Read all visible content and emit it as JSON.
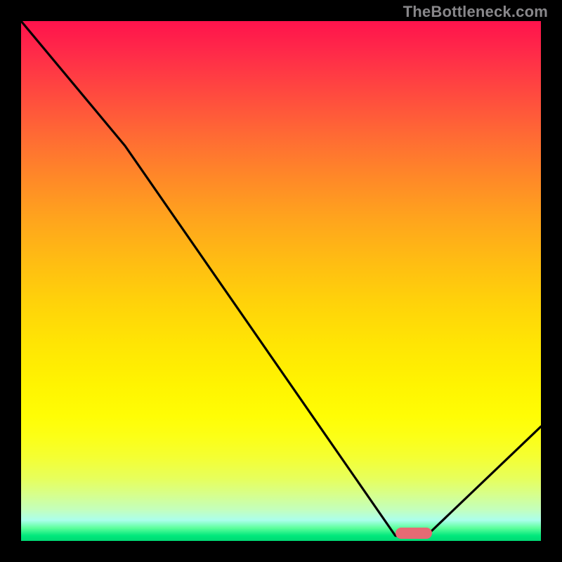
{
  "watermark": "TheBottleneck.com",
  "chart_data": {
    "type": "line",
    "title": "",
    "xlabel": "",
    "ylabel": "",
    "xlim": [
      0,
      100
    ],
    "ylim": [
      0,
      100
    ],
    "grid": false,
    "series": [
      {
        "name": "bottleneck-curve",
        "x": [
          0,
          20,
          72,
          78,
          100
        ],
        "values": [
          100,
          76,
          1,
          1,
          22
        ]
      }
    ],
    "marker": {
      "x_start": 72,
      "x_end": 79,
      "y": 1.5
    },
    "background_gradient": {
      "direction": "vertical",
      "stops": [
        {
          "pos": 0,
          "color": "#ff134c"
        },
        {
          "pos": 0.5,
          "color": "#ffd20a"
        },
        {
          "pos": 0.85,
          "color": "#fff401"
        },
        {
          "pos": 0.97,
          "color": "#5eff9d"
        },
        {
          "pos": 1.0,
          "color": "#00d873"
        }
      ]
    }
  },
  "colors": {
    "frame": "#000000",
    "curve": "#000000",
    "marker": "#e66a74",
    "watermark": "#88878a"
  }
}
